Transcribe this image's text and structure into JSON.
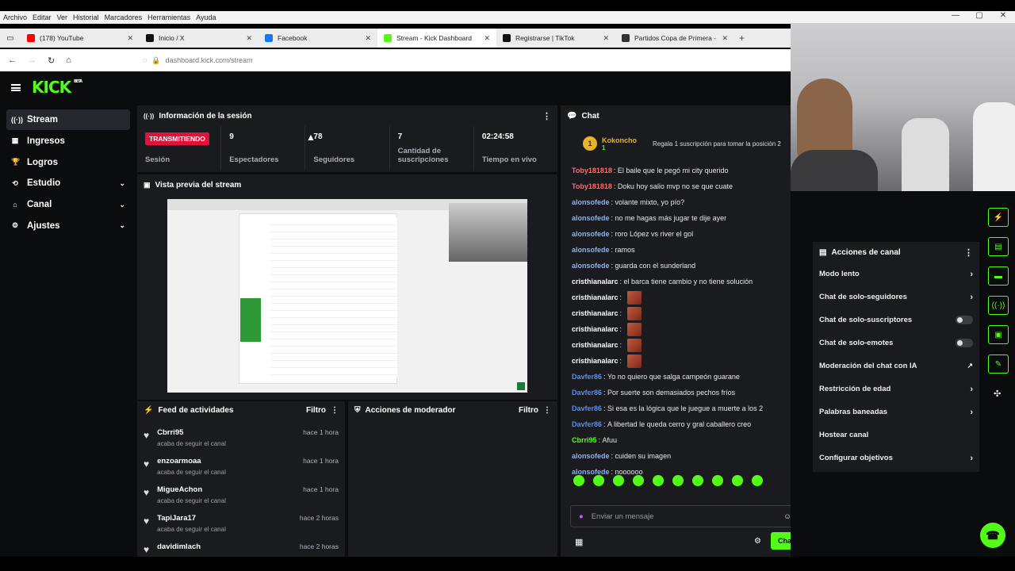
{
  "menubar": [
    "Archivo",
    "Editar",
    "Ver",
    "Historial",
    "Marcadores",
    "Herramientas",
    "Ayuda"
  ],
  "tabs": [
    {
      "title": "(178) YouTube",
      "color": "#ff0000"
    },
    {
      "title": "Inicio / X",
      "color": "#111111"
    },
    {
      "title": "Facebook",
      "color": "#1877f2"
    },
    {
      "title": "Stream - Kick Dashboard",
      "color": "#53fc18"
    },
    {
      "title": "Registrarse | TikTok",
      "color": "#111111"
    },
    {
      "title": "Partidos Copa de Primera - Fútb",
      "color": "#333333"
    }
  ],
  "url": "dashboard.kick.com/stream",
  "logo": "KICK",
  "logo_badge": "BETA",
  "sidebar": [
    {
      "label": "Stream",
      "icon": "stream-icon",
      "glyph": "((·))"
    },
    {
      "label": "Ingresos",
      "icon": "revenue-icon",
      "glyph": "▦"
    },
    {
      "label": "Logros",
      "icon": "trophy-icon",
      "glyph": "🏆"
    },
    {
      "label": "Estudio",
      "icon": "studio-icon",
      "glyph": "⟲"
    },
    {
      "label": "Canal",
      "icon": "channel-icon",
      "glyph": "⌂"
    },
    {
      "label": "Ajustes",
      "icon": "settings-icon",
      "glyph": "⚙"
    }
  ],
  "session": {
    "title": "Información de la sesión",
    "live_badge": "TRANSMITIENDO",
    "session_label": "Sesión",
    "viewers": "9",
    "viewers_label": "Espectadores",
    "followers": "78",
    "followers_label": "Seguidores",
    "subs": "7",
    "subs_label": "Cantidad de suscripciones",
    "time": "02:24:58",
    "time_label": "Tiempo en vivo"
  },
  "preview_title": "Vista previa del stream",
  "feed": {
    "title": "Feed de actividades",
    "filter": "Filtro",
    "items": [
      {
        "name": "Cbrri95",
        "action": "acaba de seguir el canal",
        "time": "hace 1 hora"
      },
      {
        "name": "enzoarmoaa",
        "action": "acaba de seguir el canal",
        "time": "hace 1 hora"
      },
      {
        "name": "MigueAchon",
        "action": "acaba de seguir el canal",
        "time": "hace 1 hora"
      },
      {
        "name": "TapiJara17",
        "action": "acaba de seguir el canal",
        "time": "hace 2 horas"
      },
      {
        "name": "davidimlach",
        "action": "",
        "time": "hace 2 horas"
      }
    ]
  },
  "mod": {
    "title": "Acciones de moderador",
    "filter": "Filtro"
  },
  "chat": {
    "title": "Chat",
    "pinned_rank": "1",
    "pinned_user": "Kokoncho",
    "pinned_count": "1",
    "pinned_gift": "Regala 1 suscripción para tomar la posición 2",
    "messages": [
      {
        "user": "Toby181818",
        "color": "#ff6b6b",
        "text": "El baile que le pegó mi city querido"
      },
      {
        "user": "Toby181818",
        "color": "#ff6b6b",
        "text": "Doku hoy salio mvp no se que cuate"
      },
      {
        "user": "alonsofede",
        "color": "#7fb3ff",
        "text": "volante mixto, yo pío?"
      },
      {
        "user": "alonsofede",
        "color": "#7fb3ff",
        "text": "no me hagas más jugar te dije ayer"
      },
      {
        "user": "alonsofede",
        "color": "#7fb3ff",
        "text": "roro López vs river el gol"
      },
      {
        "user": "alonsofede",
        "color": "#7fb3ff",
        "text": "ramos"
      },
      {
        "user": "alonsofede",
        "color": "#7fb3ff",
        "text": "guarda con el sunderland"
      },
      {
        "user": "cristhianalarc",
        "color": "#ffffff",
        "text": "el barca tiene cambio y no tiene solución"
      },
      {
        "user": "cristhianalarc",
        "color": "#ffffff",
        "text": "",
        "emote": true
      },
      {
        "user": "cristhianalarc",
        "color": "#ffffff",
        "text": "",
        "emote": true
      },
      {
        "user": "cristhianalarc",
        "color": "#ffffff",
        "text": "",
        "emote": true
      },
      {
        "user": "cristhianalarc",
        "color": "#ffffff",
        "text": "",
        "emote": true
      },
      {
        "user": "cristhianalarc",
        "color": "#ffffff",
        "text": "",
        "emote": true
      },
      {
        "user": "Davfer86",
        "color": "#5b8def",
        "text": "Yo no quiero que salga campeón guarane"
      },
      {
        "user": "Davfer86",
        "color": "#5b8def",
        "text": "Por suerte son demasiados pechos fríos"
      },
      {
        "user": "Davfer86",
        "color": "#5b8def",
        "text": "Si esa es la lógica que le juegue a muerte a los 2"
      },
      {
        "user": "Davfer86",
        "color": "#5b8def",
        "text": "A libertad le queda cerro y gral caballero creo"
      },
      {
        "user": "Cbrri95",
        "color": "#53fc18",
        "text": "Afuu"
      },
      {
        "user": "alonsofede",
        "color": "#7fb3ff",
        "text": "cuiden su imagen"
      },
      {
        "user": "alonsofede",
        "color": "#7fb3ff",
        "text": "noooooo"
      }
    ],
    "placeholder": "Enviar un mensaje",
    "send": "Chat"
  },
  "actions": {
    "title": "Acciones de canal",
    "items": [
      {
        "label": "Modo lento",
        "kind": "chev"
      },
      {
        "label": "Chat de solo-seguidores",
        "kind": "chev"
      },
      {
        "label": "Chat de solo-suscriptores",
        "kind": "toggle"
      },
      {
        "label": "Chat de solo-emotes",
        "kind": "toggle"
      },
      {
        "label": "Moderación del chat con IA",
        "kind": "ext"
      },
      {
        "label": "Restricción de edad",
        "kind": "chev"
      },
      {
        "label": "Palabras baneadas",
        "kind": "chev"
      },
      {
        "label": "Hostear canal",
        "kind": "none"
      },
      {
        "label": "Configurar objetivos",
        "kind": "chev"
      }
    ]
  },
  "accent": "#53fc18",
  "live_color": "#e3103c"
}
